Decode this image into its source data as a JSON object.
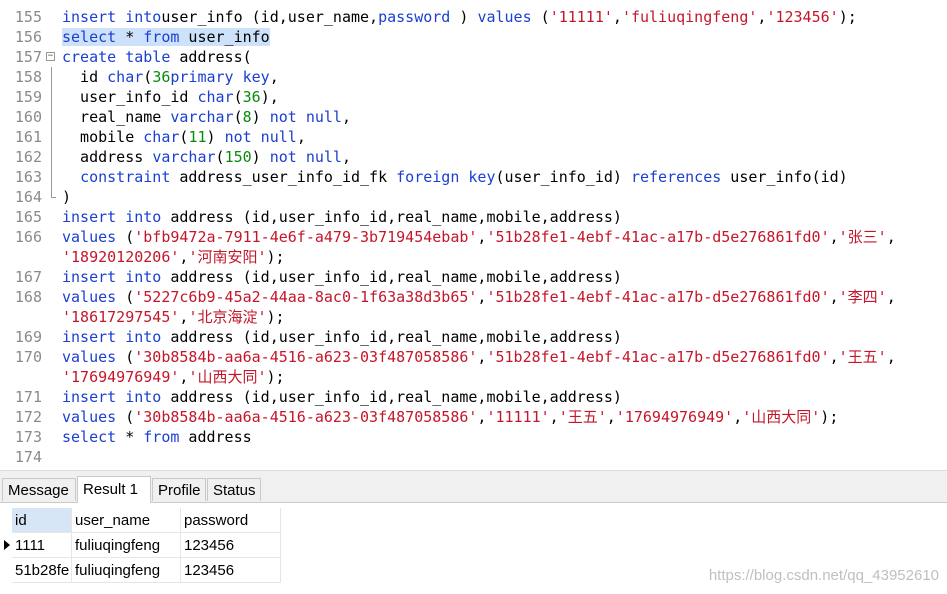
{
  "editor": {
    "lines": [
      {
        "n": "155",
        "fold": "",
        "tokens": [
          [
            "kw",
            "insert into"
          ],
          [
            "",
            "user_info (id,user_name,"
          ],
          [
            "kw",
            "password"
          ],
          [
            "",
            " ) "
          ],
          [
            "kw",
            "values"
          ],
          [
            "",
            " ("
          ],
          [
            "str",
            "'11111'"
          ],
          [
            "",
            ","
          ],
          [
            "str",
            "'fuliuqingfeng'"
          ],
          [
            "",
            ","
          ],
          [
            "str",
            "'123456'"
          ],
          [
            "",
            ");"
          ]
        ]
      },
      {
        "n": "156",
        "fold": "",
        "tokens": [
          [
            "sel-kw",
            "select"
          ],
          [
            "sel",
            " * "
          ],
          [
            "sel-kw",
            "from"
          ],
          [
            "sel",
            " user_info"
          ]
        ]
      },
      {
        "n": "157",
        "fold": "box",
        "tokens": [
          [
            "kw",
            "create table"
          ],
          [
            "",
            " address("
          ]
        ]
      },
      {
        "n": "158",
        "fold": "bar",
        "tokens": [
          [
            "",
            "  id "
          ],
          [
            "kw",
            "char"
          ],
          [
            "",
            "("
          ],
          [
            "num",
            "36"
          ],
          [
            ") "
          ],
          [
            "kw",
            "primary key"
          ],
          [
            "",
            ","
          ]
        ]
      },
      {
        "n": "159",
        "fold": "bar",
        "tokens": [
          [
            "",
            "  user_info_id "
          ],
          [
            "kw",
            "char"
          ],
          [
            "",
            "("
          ],
          [
            "num",
            "36"
          ],
          [
            "",
            "),"
          ]
        ]
      },
      {
        "n": "160",
        "fold": "bar",
        "tokens": [
          [
            "",
            "  real_name "
          ],
          [
            "kw",
            "varchar"
          ],
          [
            "",
            "("
          ],
          [
            "num",
            "8"
          ],
          [
            "",
            ") "
          ],
          [
            "kw",
            "not null"
          ],
          [
            "",
            ","
          ]
        ]
      },
      {
        "n": "161",
        "fold": "bar",
        "tokens": [
          [
            "",
            "  mobile "
          ],
          [
            "kw",
            "char"
          ],
          [
            "",
            "("
          ],
          [
            "num",
            "11"
          ],
          [
            "",
            ") "
          ],
          [
            "kw",
            "not null"
          ],
          [
            "",
            ","
          ]
        ]
      },
      {
        "n": "162",
        "fold": "bar",
        "tokens": [
          [
            "",
            "  address "
          ],
          [
            "kw",
            "varchar"
          ],
          [
            "",
            "("
          ],
          [
            "num",
            "150"
          ],
          [
            "",
            ") "
          ],
          [
            "kw",
            "not null"
          ],
          [
            "",
            ","
          ]
        ]
      },
      {
        "n": "163",
        "fold": "bar",
        "tokens": [
          [
            "",
            "  "
          ],
          [
            "kw",
            "constraint"
          ],
          [
            "",
            " address_user_info_id_fk "
          ],
          [
            "kw",
            "foreign key"
          ],
          [
            "",
            "(user_info_id) "
          ],
          [
            "kw",
            "references"
          ],
          [
            "",
            " user_info(id)"
          ]
        ]
      },
      {
        "n": "164",
        "fold": "end",
        "tokens": [
          [
            "",
            ")"
          ]
        ]
      },
      {
        "n": "165",
        "fold": "",
        "tokens": [
          [
            "kw",
            "insert into"
          ],
          [
            "",
            " address (id,user_info_id,real_name,mobile,address)"
          ]
        ]
      },
      {
        "n": "166",
        "fold": "",
        "tokens": [
          [
            "kw",
            "values"
          ],
          [
            "",
            " ("
          ],
          [
            "str",
            "'bfb9472a-7911-4e6f-a479-3b719454ebab'"
          ],
          [
            "",
            ","
          ],
          [
            "str",
            "'51b28fe1-4ebf-41ac-a17b-d5e276861fd0'"
          ],
          [
            "",
            ","
          ],
          [
            "str",
            "'张三'"
          ],
          [
            "",
            ","
          ]
        ]
      },
      {
        "n": "",
        "fold": "",
        "tokens": [
          [
            "str",
            "'18920120206'"
          ],
          [
            "",
            ","
          ],
          [
            "str",
            "'河南安阳'"
          ],
          [
            "",
            ");"
          ]
        ]
      },
      {
        "n": "167",
        "fold": "",
        "tokens": [
          [
            "kw",
            "insert into"
          ],
          [
            "",
            " address (id,user_info_id,real_name,mobile,address)"
          ]
        ]
      },
      {
        "n": "168",
        "fold": "",
        "tokens": [
          [
            "kw",
            "values"
          ],
          [
            "",
            " ("
          ],
          [
            "str",
            "'5227c6b9-45a2-44aa-8ac0-1f63a38d3b65'"
          ],
          [
            "",
            ","
          ],
          [
            "str",
            "'51b28fe1-4ebf-41ac-a17b-d5e276861fd0'"
          ],
          [
            "",
            ","
          ],
          [
            "str",
            "'李四'"
          ],
          [
            "",
            ","
          ]
        ]
      },
      {
        "n": "",
        "fold": "",
        "tokens": [
          [
            "str",
            "'18617297545'"
          ],
          [
            "",
            ","
          ],
          [
            "str",
            "'北京海淀'"
          ],
          [
            "",
            ");"
          ]
        ]
      },
      {
        "n": "169",
        "fold": "",
        "tokens": [
          [
            "kw",
            "insert into"
          ],
          [
            "",
            " address (id,user_info_id,real_name,mobile,address)"
          ]
        ]
      },
      {
        "n": "170",
        "fold": "",
        "tokens": [
          [
            "kw",
            "values"
          ],
          [
            "",
            " ("
          ],
          [
            "str",
            "'30b8584b-aa6a-4516-a623-03f487058586'"
          ],
          [
            "",
            ","
          ],
          [
            "str",
            "'51b28fe1-4ebf-41ac-a17b-d5e276861fd0'"
          ],
          [
            "",
            ","
          ],
          [
            "str",
            "'王五'"
          ],
          [
            "",
            ","
          ]
        ]
      },
      {
        "n": "",
        "fold": "",
        "tokens": [
          [
            "str",
            "'17694976949'"
          ],
          [
            "",
            ","
          ],
          [
            "str",
            "'山西大同'"
          ],
          [
            "",
            ");"
          ]
        ]
      },
      {
        "n": "171",
        "fold": "",
        "tokens": [
          [
            "kw",
            "insert into"
          ],
          [
            "",
            " address (id,user_info_id,real_name,mobile,address)"
          ]
        ]
      },
      {
        "n": "172",
        "fold": "",
        "tokens": [
          [
            "kw",
            "values"
          ],
          [
            "",
            " ("
          ],
          [
            "str",
            "'30b8584b-aa6a-4516-a623-03f487058586'"
          ],
          [
            "",
            ","
          ],
          [
            "str",
            "'11111'"
          ],
          [
            "",
            ","
          ],
          [
            "str",
            "'王五'"
          ],
          [
            "",
            ","
          ],
          [
            "str",
            "'17694976949'"
          ],
          [
            "",
            ","
          ],
          [
            "str",
            "'山西大同'"
          ],
          [
            "",
            ");"
          ]
        ]
      },
      {
        "n": "173",
        "fold": "",
        "tokens": [
          [
            "kw",
            "select"
          ],
          [
            "",
            " * "
          ],
          [
            "kw",
            "from"
          ],
          [
            "",
            " address"
          ]
        ]
      },
      {
        "n": "174",
        "fold": "",
        "tokens": []
      }
    ]
  },
  "result_tabs": [
    "Message",
    "Result 1",
    "Profile",
    "Status"
  ],
  "active_tab": "Result 1",
  "grid": {
    "columns": [
      "id",
      "user_name",
      "password"
    ],
    "rows": [
      [
        "1111",
        "fuliuqingfeng",
        "123456"
      ],
      [
        "51b28fe",
        "fuliuqingfeng",
        "123456"
      ]
    ]
  },
  "watermark": "https://blog.csdn.net/qq_43952610"
}
